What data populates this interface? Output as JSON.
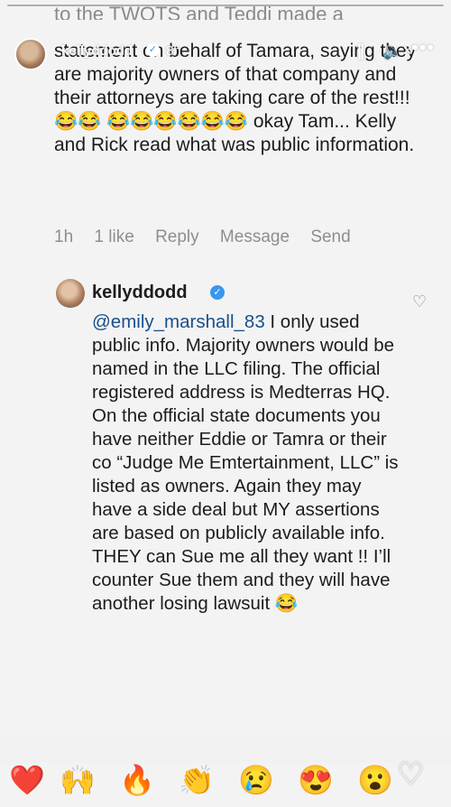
{
  "story": {
    "username": "kellyddodd",
    "time": "8h",
    "clipped_top_text": "to the TWOTS and Teddi made a",
    "verified_glyph": "✓",
    "pause_glyph": "||",
    "mute_glyph": "🔈×",
    "more_glyph": "•••"
  },
  "previous_comment": {
    "text": "statement on behalf of Tamara, saying they are majority owners of that company and their attorneys are taking care of the rest!!! 😂😂 😂😂😂😂😂😂 okay Tam... Kelly and Rick read what was public information.",
    "time": "1h",
    "likes": "1 like",
    "reply_label": "Reply",
    "message_label": "Message",
    "send_label": "Send"
  },
  "reply": {
    "username": "kellyddodd",
    "verified_glyph": "✓",
    "mention": "@emily_marshall_83",
    "text": " I only used public info.  Majority owners would be named in the LLC filing. The official registered address is Medterras HQ.  On the official state documents you have neither Eddie or Tamra or their co “Judge Me Emtertainment, LLC” is listed as owners.  Again they may have a side deal but MY assertions are based on publicly available info.  THEY can Sue me all they want !! I’ll counter Sue them and they will have another losing lawsuit 😂",
    "like_glyph": "♡"
  },
  "reactions": [
    {
      "name": "heart",
      "emoji": "❤️"
    },
    {
      "name": "raising-hands",
      "emoji": "🙌"
    },
    {
      "name": "fire",
      "emoji": "🔥"
    },
    {
      "name": "clapping-hands",
      "emoji": "👏"
    },
    {
      "name": "crying-face",
      "emoji": "😢"
    },
    {
      "name": "heart-eyes",
      "emoji": "😍"
    },
    {
      "name": "surprised-face",
      "emoji": "😮"
    },
    {
      "name": "laughing-face",
      "emoji": "😂"
    }
  ],
  "like_story_glyph": "♡",
  "colors": {
    "background": "#f1f1f1",
    "text": "#1c1c1c",
    "secondary_text": "#8e8e8e",
    "verified_blue": "#3897f0",
    "mention": "#1a4e8c"
  }
}
